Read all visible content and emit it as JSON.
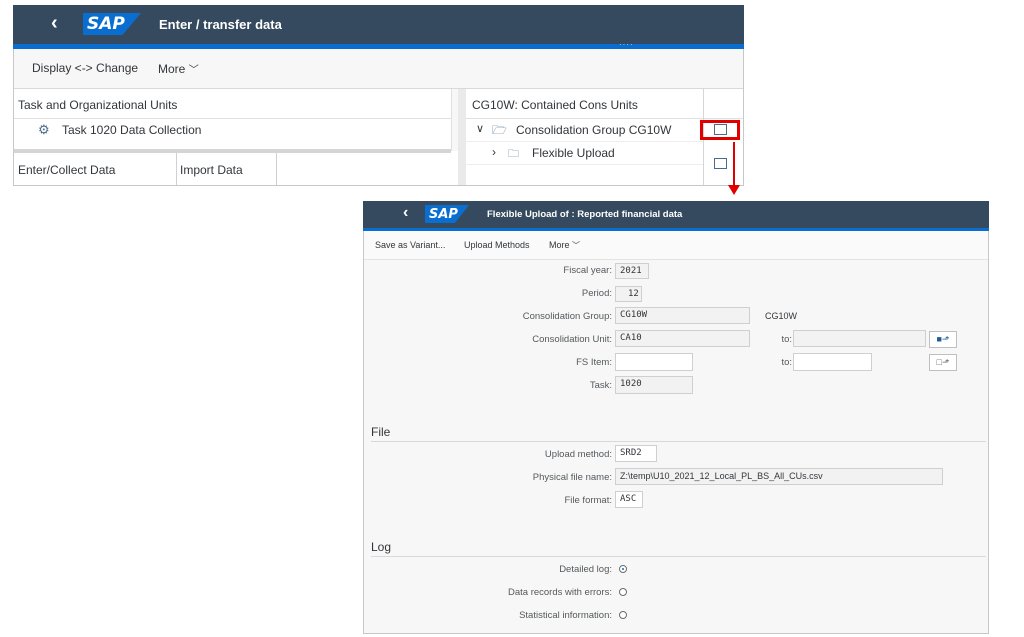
{
  "top": {
    "logo": "SAP",
    "title": "Enter / transfer data",
    "toolbar": {
      "display_change": "Display <-> Change",
      "more": "More"
    },
    "left_panel": {
      "header": "Task and Organizational Units",
      "task_item": "Task 1020 Data Collection",
      "tabs": [
        "Enter/Collect Data",
        "Import Data"
      ]
    },
    "right_panel": {
      "header": "CG10W: Contained Cons Units",
      "group_item": "Consolidation Group CG10W",
      "upload_item": "Flexible Upload"
    }
  },
  "bottom": {
    "logo": "SAP",
    "title": "Flexible Upload of : Reported financial data",
    "toolbar": {
      "save_variant": "Save as Variant...",
      "upload_methods": "Upload Methods",
      "more": "More"
    },
    "params": {
      "fiscal_year_label": "Fiscal year:",
      "fiscal_year": "2021",
      "period_label": "Period:",
      "period": "12",
      "cons_group_label": "Consolidation Group:",
      "cons_group": "CG10W",
      "cons_group_text": "CG10W",
      "cons_unit_label": "Consolidation Unit:",
      "cons_unit": "CA10",
      "to_label": "to:",
      "fs_item_label": "FS Item:",
      "fs_item": "",
      "fs_to_label": "to:",
      "task_label": "Task:",
      "task": "1020"
    },
    "file": {
      "section": "File",
      "upload_method_label": "Upload method:",
      "upload_method": "SRD2",
      "physical_file_label": "Physical file name:",
      "physical_file": "Z:\\temp\\U10_2021_12_Local_PL_BS_All_CUs.csv",
      "file_format_label": "File format:",
      "file_format": "ASC"
    },
    "log": {
      "section": "Log",
      "detailed_label": "Detailed log:",
      "errors_label": "Data records with errors:",
      "stats_label": "Statistical information:",
      "detailed_selected": true
    }
  },
  "colors": {
    "shell": "#354a5f",
    "brand": "#0a6ed1",
    "highlight": "#e00000"
  }
}
